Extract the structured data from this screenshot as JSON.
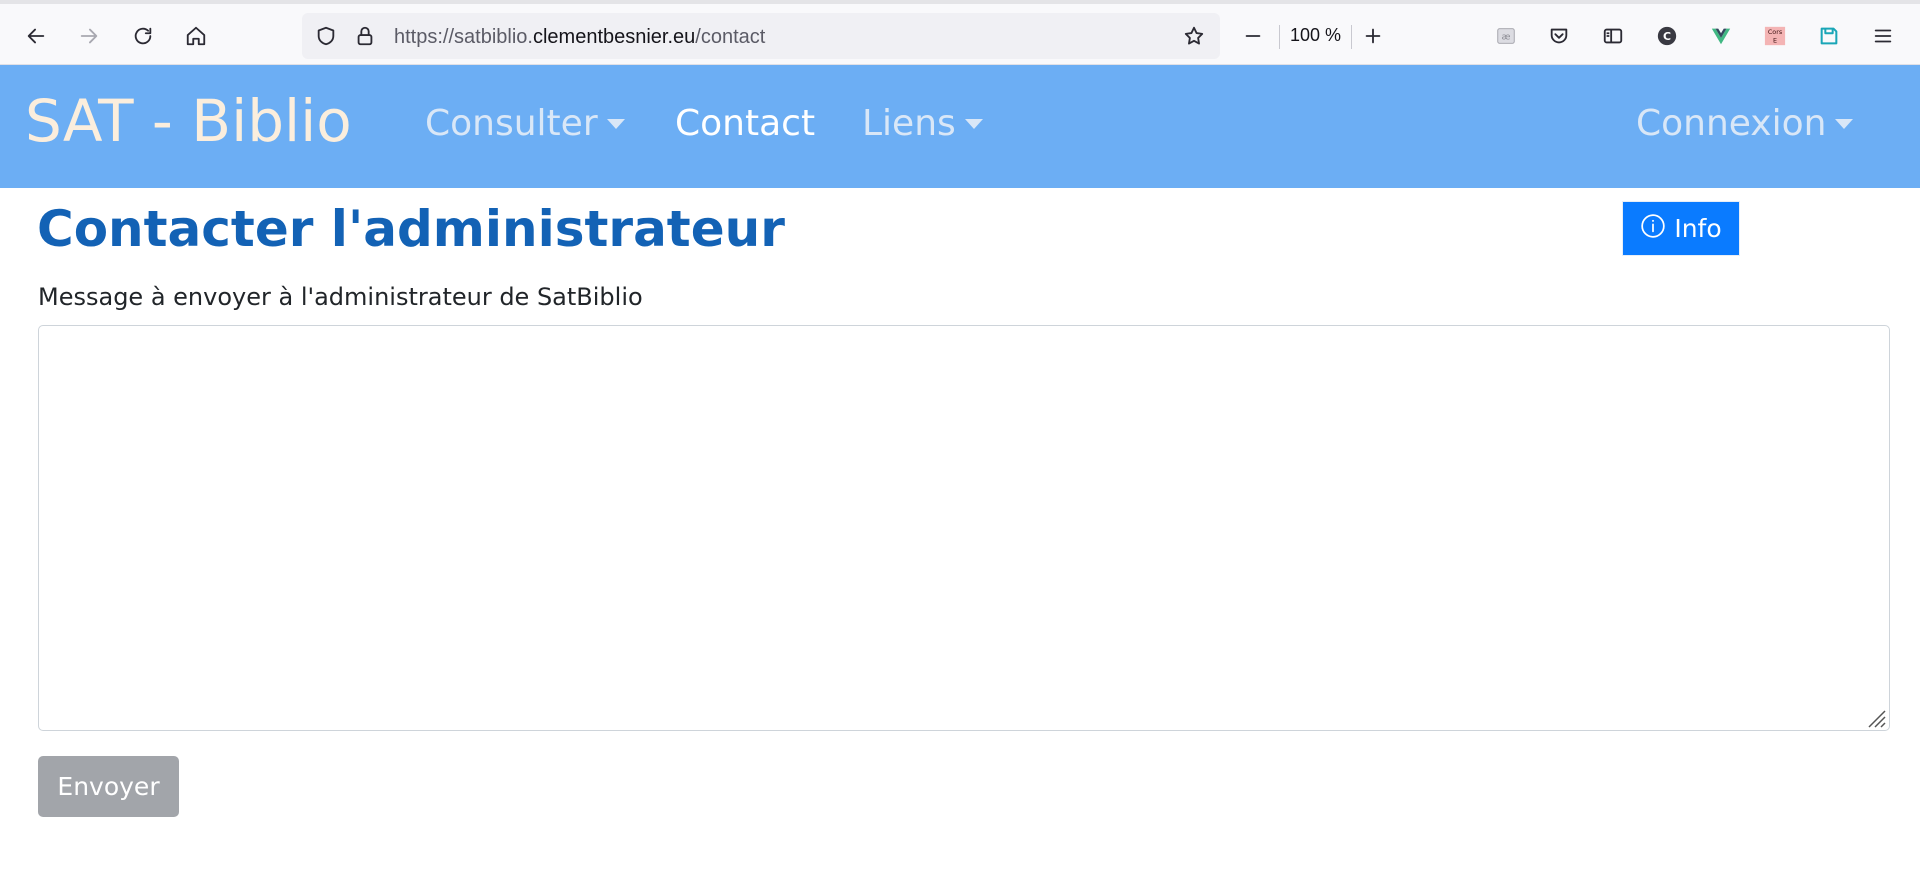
{
  "browser": {
    "url_prefix": "https://satbiblio.",
    "url_domain": "clementbesnier.eu",
    "url_path": "/contact",
    "zoom": "100 %",
    "extension_cors_label": "Cors E"
  },
  "navbar": {
    "brand": "SAT - Biblio",
    "items": [
      {
        "label": "Consulter",
        "dropdown": true
      },
      {
        "label": "Contact",
        "dropdown": false,
        "active": true
      },
      {
        "label": "Liens",
        "dropdown": true
      }
    ],
    "login": {
      "label": "Connexion",
      "dropdown": true
    },
    "background_color": "#6caef4",
    "brand_color": "#fbeedd"
  },
  "main": {
    "title": "Contacter l'administrateur",
    "info_button": "Info",
    "message_label": "Message à envoyer à l'administrateur de SatBiblio",
    "message_value": "",
    "send_button": "Envoyer"
  },
  "colors": {
    "title": "#1362b5",
    "info_button": "#0a7bff",
    "send_button_disabled": "#a2a5aa"
  }
}
